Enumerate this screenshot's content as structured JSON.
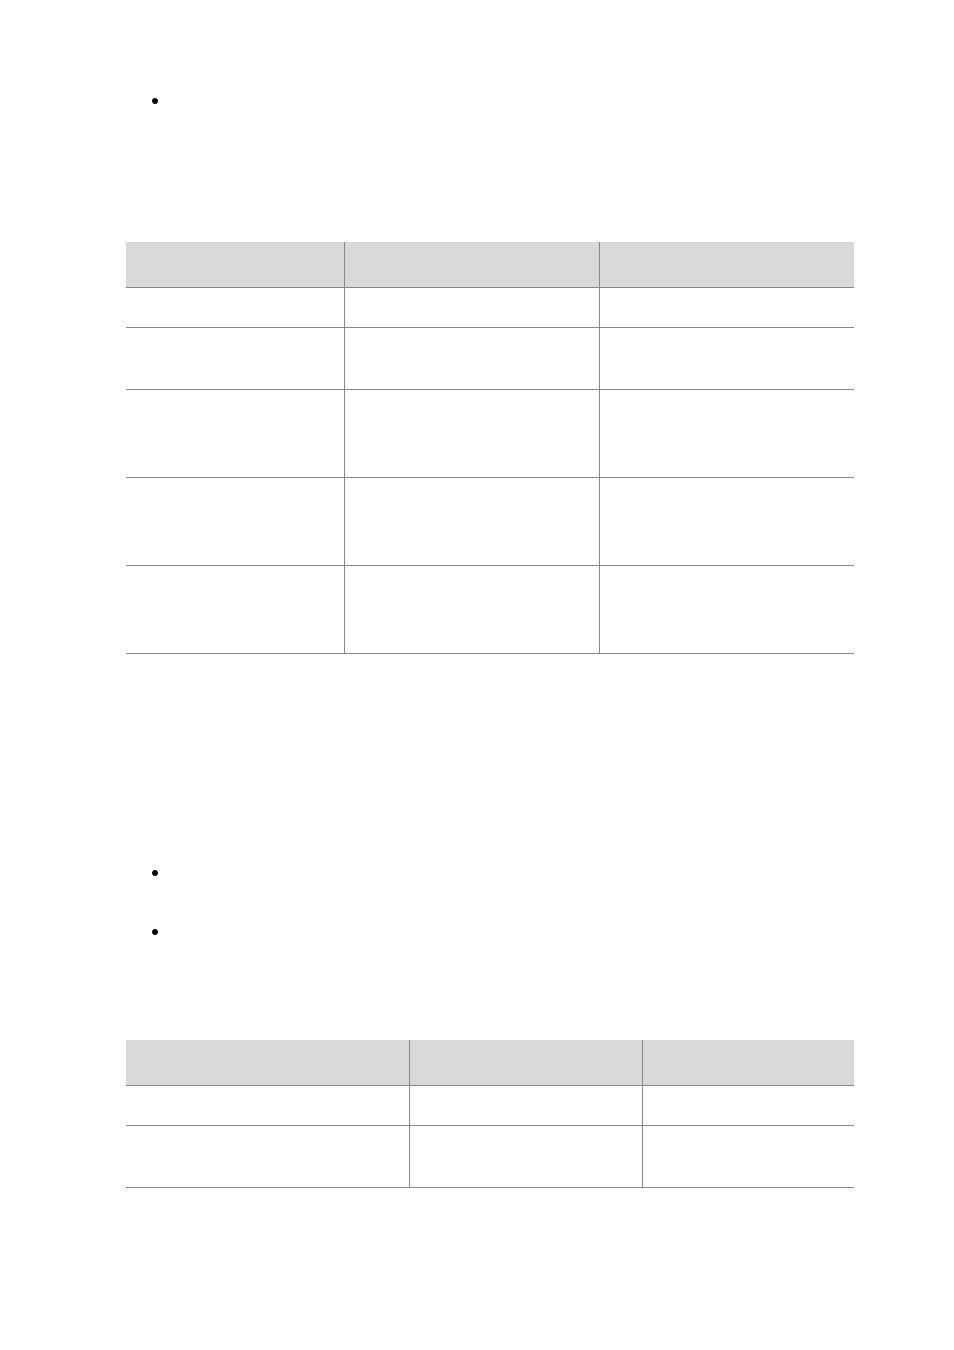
{
  "bullets": [
    "",
    "",
    ""
  ],
  "table1": {
    "headers": [
      "",
      "",
      ""
    ],
    "rows": [
      [
        "",
        "",
        ""
      ],
      [
        "",
        "",
        ""
      ],
      [
        "",
        "",
        ""
      ],
      [
        "",
        "",
        ""
      ],
      [
        "",
        "",
        ""
      ]
    ]
  },
  "table2": {
    "headers": [
      "",
      "",
      ""
    ],
    "rows": [
      [
        "",
        "",
        ""
      ],
      [
        "",
        "",
        ""
      ]
    ]
  }
}
